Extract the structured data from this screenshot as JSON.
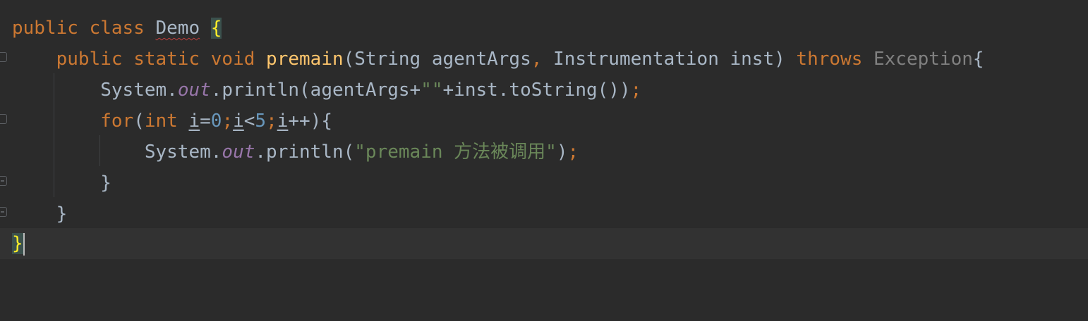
{
  "editor": {
    "lines": [
      {
        "t1": "public class ",
        "class_name": "Demo",
        "brace": "{"
      },
      {
        "indent": "    ",
        "kw": "public static void ",
        "method": "premain",
        "params_a": "(String agentArgs",
        "comma": ",",
        "params_b": " Instrumentation inst) ",
        "throws": "throws",
        "exc": " Exception",
        "brace": "{"
      },
      {
        "indent": "        ",
        "sys": "System.",
        "field": "out",
        "call": ".println(agentArgs+",
        "str": "\"\"",
        "rest": "+inst.toString())",
        "semi": ";"
      },
      {
        "indent": "        ",
        "for": "for",
        "paren": "(",
        "int": "int ",
        "v1": "i",
        "eq": "=",
        "zero": "0",
        "semi1": ";",
        "v2": "i",
        "lt": "<",
        "five": "5",
        "semi2": ";",
        "v3": "i",
        "inc": "++){"
      },
      {
        "indent": "            ",
        "sys": "System.",
        "field": "out",
        "call": ".println(",
        "str": "\"premain 方法被调用\"",
        "close": ")",
        "semi": ";"
      },
      {
        "indent": "        ",
        "brace": "}"
      },
      {
        "indent": "    ",
        "brace": "}"
      },
      {
        "brace": "}"
      }
    ]
  }
}
